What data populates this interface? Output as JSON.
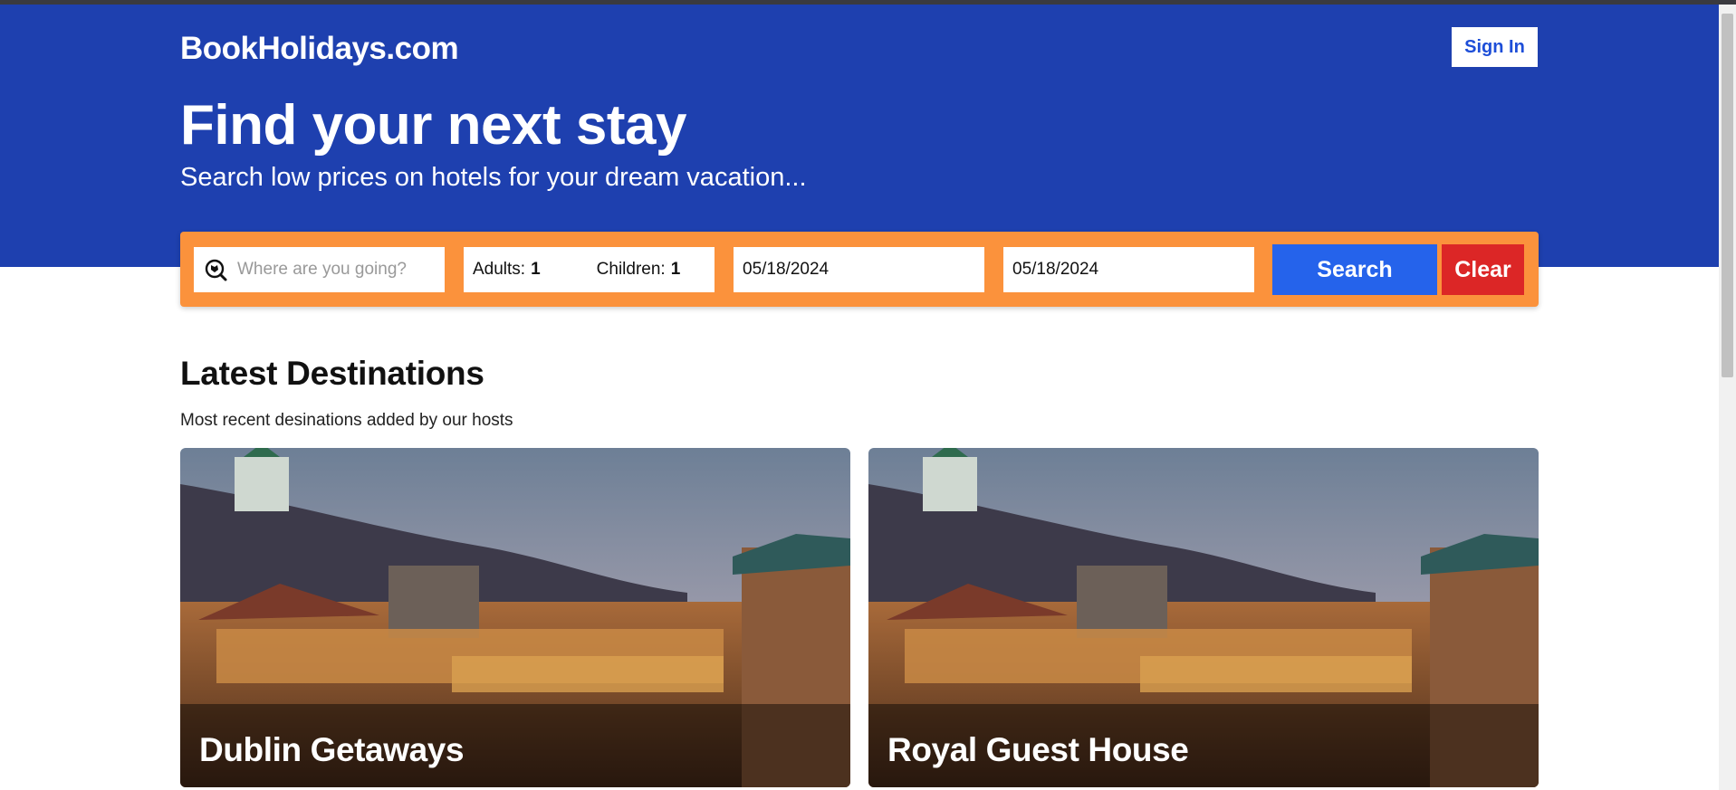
{
  "header": {
    "logo": "BookHolidays.com",
    "sign_in_label": "Sign In"
  },
  "hero": {
    "title": "Find your next stay",
    "subtitle": "Search low prices on hotels for your dream vacation..."
  },
  "search": {
    "destination_placeholder": "Where are you going?",
    "adults_label": "Adults:",
    "adults_value": "1",
    "children_label": "Children:",
    "children_value": "1",
    "check_in": "05/18/2024",
    "check_out": "05/18/2024",
    "search_label": "Search",
    "clear_label": "Clear"
  },
  "latest": {
    "title": "Latest Destinations",
    "subtitle": "Most recent desinations added by our hosts",
    "cards": [
      {
        "name": "Dublin Getaways"
      },
      {
        "name": "Royal Guest House"
      }
    ]
  },
  "colors": {
    "hero_bg": "#1e40af",
    "search_bar_bg": "#fb923c",
    "search_button": "#2563eb",
    "clear_button": "#dc2626"
  },
  "icons": {
    "destination": "map-search-icon"
  }
}
